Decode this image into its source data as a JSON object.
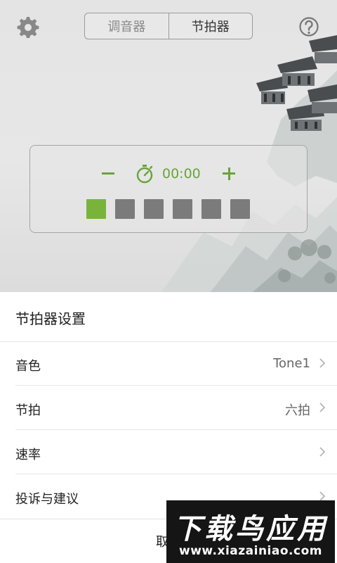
{
  "header": {
    "settings_icon": "gear-icon",
    "help_icon": "question-circle-icon",
    "tabs": [
      {
        "label": "调音器",
        "active": false
      },
      {
        "label": "节拍器",
        "active": true
      }
    ]
  },
  "metronome": {
    "timer": "00:00",
    "beat_count": 6,
    "active_beat": 1,
    "accent_color": "#6aa33c"
  },
  "settings_sheet": {
    "title": "节拍器设置",
    "rows": [
      {
        "label": "音色",
        "value": "Tone1"
      },
      {
        "label": "节拍",
        "value": "六拍"
      },
      {
        "label": "速率",
        "value": ""
      },
      {
        "label": "投诉与建议",
        "value": ""
      }
    ],
    "cancel_label": "取消"
  },
  "watermark": {
    "title": "下载鸟应用",
    "url": "www.xiazainiao.com"
  }
}
